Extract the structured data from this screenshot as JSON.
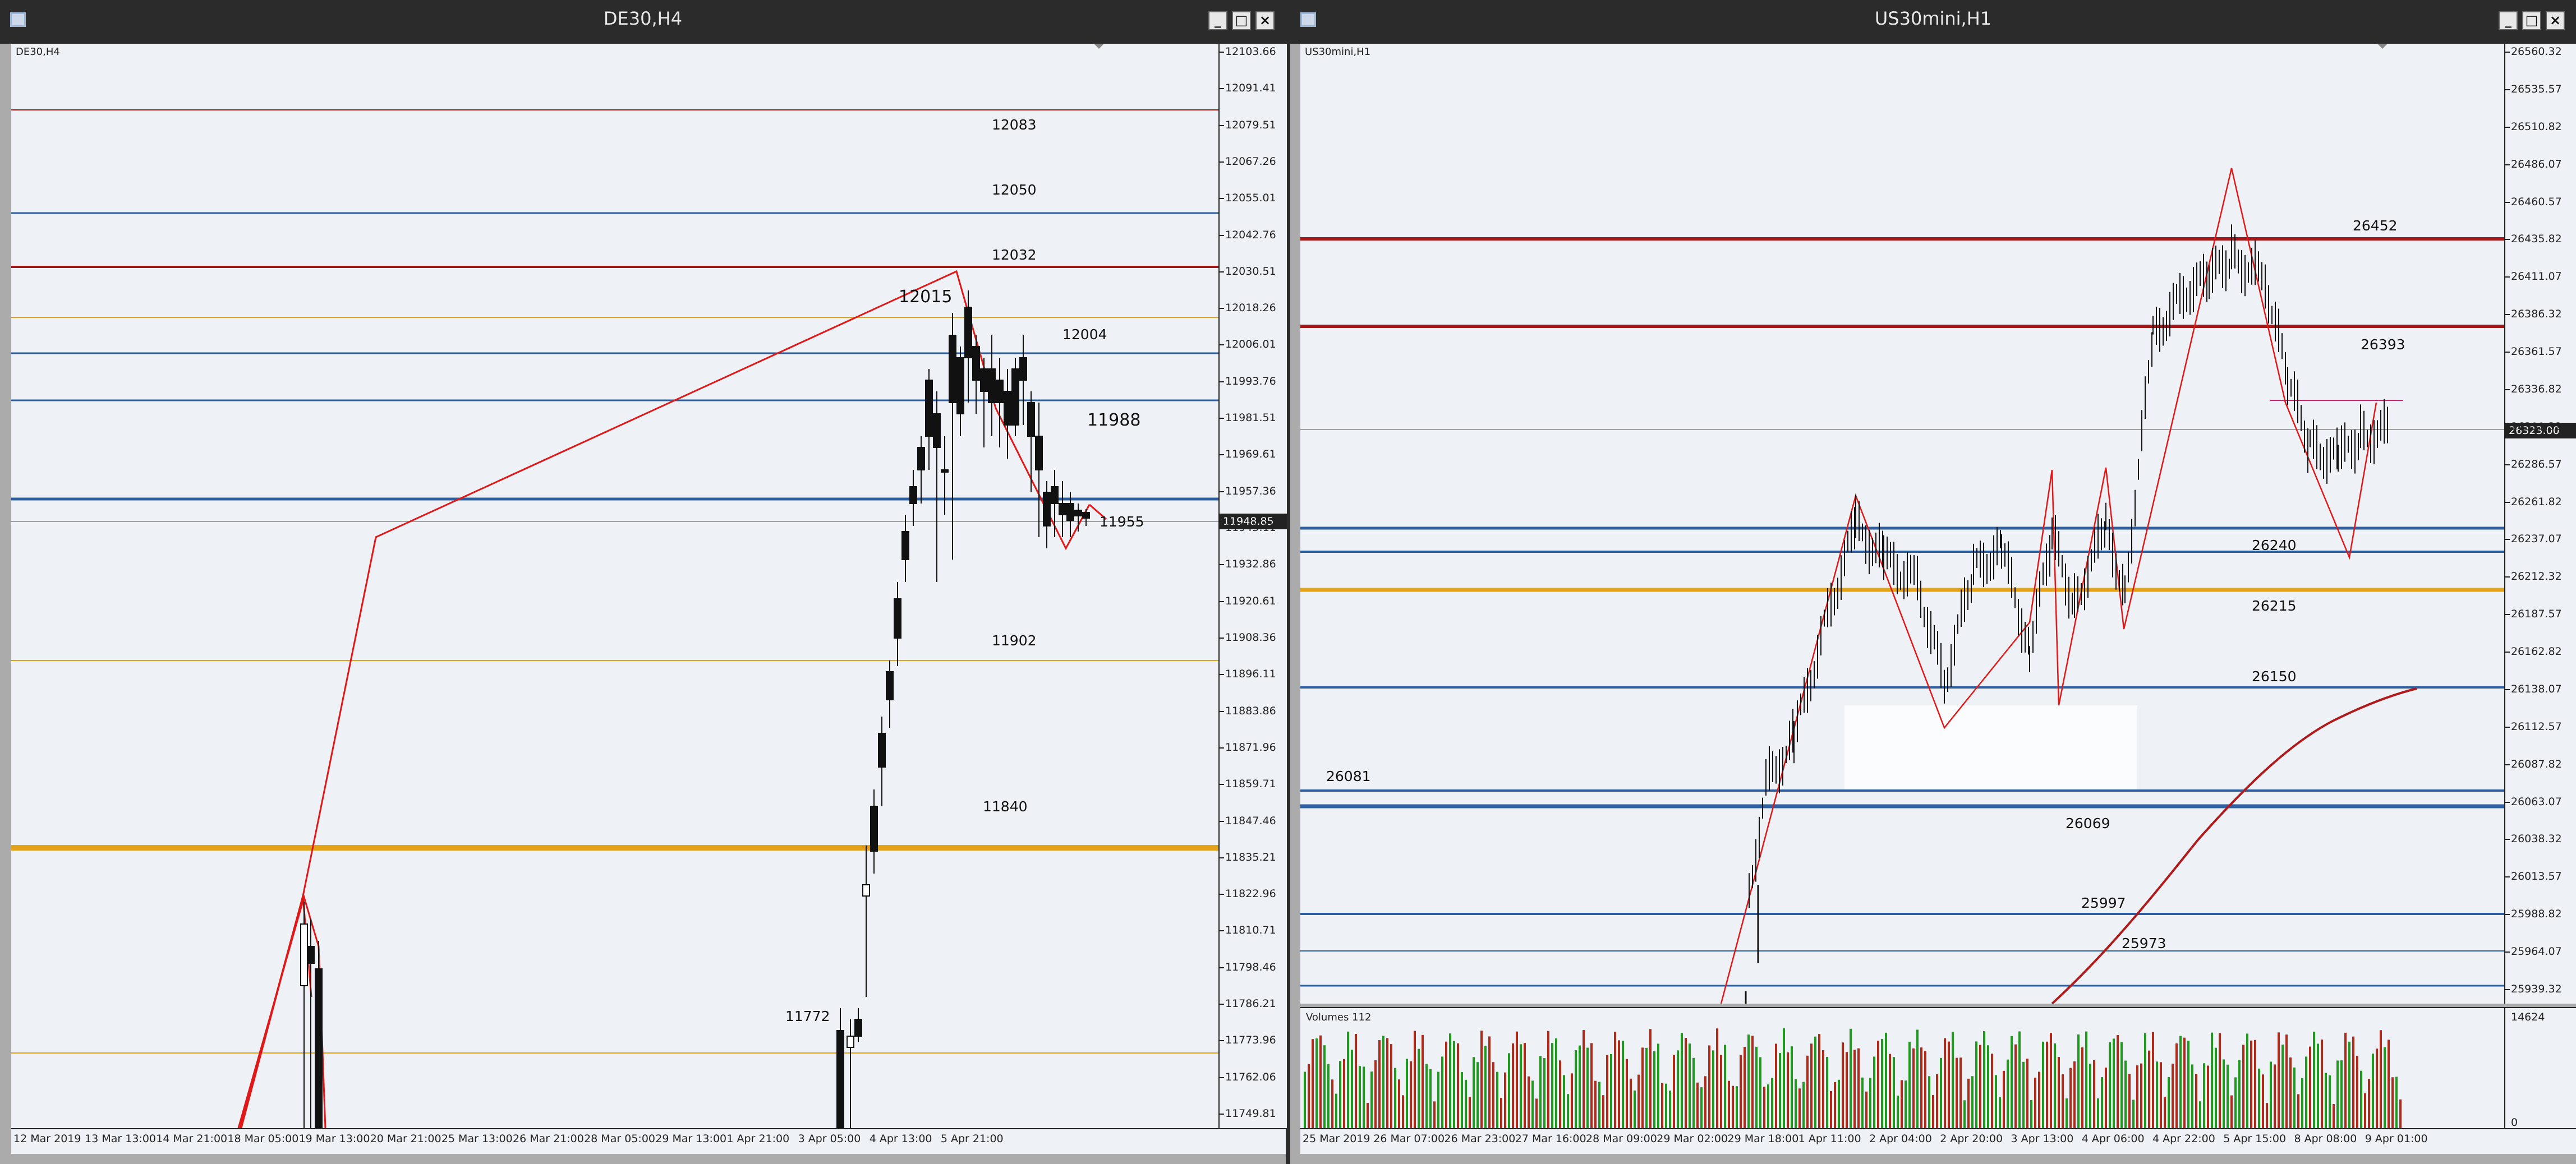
{
  "left_window": {
    "title": "DE30,H4",
    "symbol_label": "DE30,H4",
    "price_axis": [
      "12103.66",
      "12091.41",
      "12079.51",
      "12067.26",
      "12055.01",
      "12042.76",
      "12030.51",
      "12018.26",
      "12006.01",
      "11993.76",
      "11981.51",
      "11969.61",
      "11957.36",
      "11945.11",
      "11932.86",
      "11920.61",
      "11908.36",
      "11896.11",
      "11883.86",
      "11871.96",
      "11859.71",
      "11847.46",
      "11835.21",
      "11822.96",
      "11810.71",
      "11798.46",
      "11786.21",
      "11773.96",
      "11762.06",
      "11749.81"
    ],
    "current_price": "11948.85",
    "time_axis": [
      "12 Mar 2019",
      "13 Mar 13:00",
      "14 Mar 21:00",
      "18 Mar 05:00",
      "19 Mar 13:00",
      "20 Mar 21:00",
      "25 Mar 13:00",
      "26 Mar 21:00",
      "28 Mar 05:00",
      "29 Mar 13:00",
      "1 Apr 21:00",
      "3 Apr 05:00",
      "4 Apr 13:00",
      "5 Apr 21:00"
    ],
    "level_labels": [
      "12083",
      "12050",
      "12032",
      "12015",
      "12004",
      "11988",
      "11955",
      "11902",
      "11840",
      "11772"
    ],
    "colors": {
      "blue": "#2d5fa0",
      "red": "#a01818",
      "orange": "#e2a21a",
      "zigzag": "#e01818"
    }
  },
  "right_window": {
    "title": "US30mini,H1",
    "symbol_label": "US30mini,H1",
    "price_axis": [
      "26560.32",
      "26535.57",
      "26510.82",
      "26486.07",
      "26460.57",
      "26435.82",
      "26411.07",
      "26386.32",
      "26361.57",
      "26336.82",
      "26311.32",
      "26286.57",
      "26261.82",
      "26237.07",
      "26212.32",
      "26187.57",
      "26162.82",
      "26138.07",
      "26112.57",
      "26087.82",
      "26063.07",
      "26038.32",
      "26013.57",
      "25988.82",
      "25964.07",
      "25939.32"
    ],
    "current_price": "26323.00",
    "time_axis": [
      "25 Mar 2019",
      "26 Mar 07:00",
      "26 Mar 23:00",
      "27 Mar 16:00",
      "28 Mar 09:00",
      "29 Mar 02:00",
      "29 Mar 18:00",
      "1 Apr 11:00",
      "2 Apr 04:00",
      "2 Apr 20:00",
      "3 Apr 13:00",
      "4 Apr 06:00",
      "4 Apr 22:00",
      "5 Apr 15:00",
      "8 Apr 08:00",
      "9 Apr 01:00"
    ],
    "level_labels": [
      "26452",
      "26393",
      "26240",
      "26215",
      "26150",
      "26081",
      "26069",
      "25997",
      "25973"
    ],
    "volumes_label": "Volumes 112",
    "volume_axis": [
      "14624",
      "0"
    ],
    "colors": {
      "blue": "#2d5fa0",
      "red": "#a01818",
      "orange": "#e2a21a",
      "ma": "#b01a1a",
      "vol_up": "#1f9a1f",
      "vol_down": "#b02a1a"
    }
  }
}
